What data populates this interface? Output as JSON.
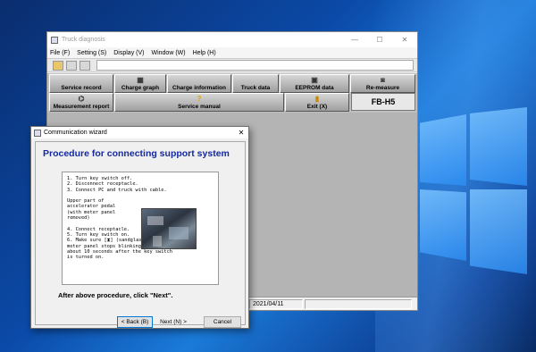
{
  "app": {
    "title": "Truck diagnosis",
    "window_controls": {
      "minimize": "—",
      "maximize": "☐",
      "close": "✕"
    },
    "menu": [
      "File (F)",
      "Setting (S)",
      "Display (V)",
      "Window (W)",
      "Help (H)"
    ],
    "toolbar_icons": [
      "folder-icon",
      "save-icon",
      "print-icon"
    ],
    "buttons_row1": [
      {
        "label": "Service record",
        "icon": "record-icon"
      },
      {
        "label": "Charge graph",
        "icon": "graph-icon"
      },
      {
        "label": "Charge information",
        "icon": "info-icon"
      },
      {
        "label": "Truck data",
        "icon": "truck-icon"
      },
      {
        "label": "EEPROM data",
        "icon": "chip-icon"
      },
      {
        "label": "Re-measure",
        "icon": "measure-icon"
      }
    ],
    "buttons_row2": [
      {
        "label": "Measurement report",
        "icon": "report-icon"
      },
      {
        "label": "Service manual",
        "icon": "manual-icon"
      },
      {
        "label": "Exit (X)",
        "icon": "exit-icon"
      }
    ],
    "model": "FB-H5",
    "status": {
      "date": "2021/04/11"
    }
  },
  "wizard": {
    "title": "Communication wizard",
    "close": "✕",
    "heading": "Procedure for connecting support system",
    "steps": [
      "1. Turn key switch off.",
      "2. Disconnect receptacle.",
      "3. Connect PC and truck with cable.",
      "",
      "   Upper part of",
      "   accelerator pedal",
      "   (with meter panel",
      "   removed)",
      "",
      "4. Connect receptacle.",
      "5. Turn key switch on.",
      "6. Make sure [⧗] (sandglass icon) on the",
      "   meter panel stops blinking to stay on",
      "   about 10 seconds after the key switch",
      "   is turned on."
    ],
    "after_text": "After above procedure, click \"Next\".",
    "back_label": "< Back (B)",
    "next_label": "Next (N) >",
    "cancel_label": "Cancel"
  }
}
